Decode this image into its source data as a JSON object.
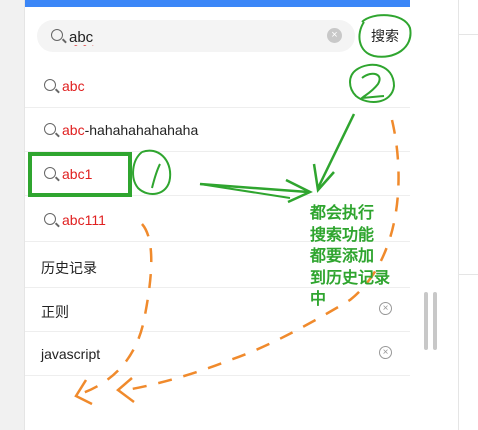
{
  "search": {
    "value": "abc",
    "clear_icon": "clear-circle-icon",
    "button_label": "搜索"
  },
  "suggestions": [
    {
      "match": "abc",
      "rest": ""
    },
    {
      "match": "abc",
      "rest": "-hahahahahahaha"
    },
    {
      "match": "abc",
      "rest": "1"
    },
    {
      "match": "abc",
      "rest": "111"
    }
  ],
  "history": {
    "title": "历史记录",
    "items": [
      {
        "label": "正则",
        "delete_icon": "delete-circle-icon"
      },
      {
        "label": "javascript",
        "delete_icon": "delete-circle-icon"
      }
    ]
  },
  "annotation": {
    "note_lines": [
      "都会执行",
      "搜索功能",
      "都要添加",
      "到历史记录",
      "中"
    ],
    "colors": {
      "green": "#2fa52f",
      "orange": "#f08a2c",
      "highlight": "#e02020",
      "topbar": "#3b86f7"
    }
  }
}
